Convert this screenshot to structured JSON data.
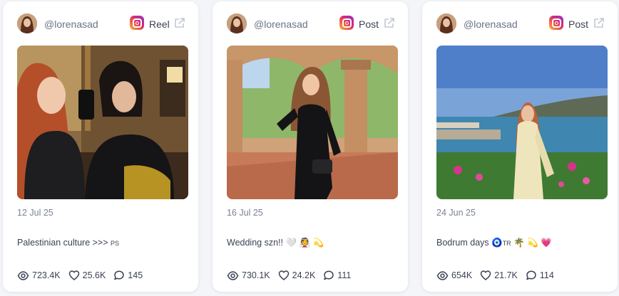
{
  "cards": [
    {
      "handle": "@lorenasad",
      "post_type": "Reel",
      "platform_icon": "instagram-icon",
      "date": "12 Jul 25",
      "caption": "Palestinian culture >>> ",
      "caption_tag": "PS",
      "views": "723.4K",
      "likes": "25.6K",
      "comments": "145"
    },
    {
      "handle": "@lorenasad",
      "post_type": "Post",
      "platform_icon": "instagram-icon",
      "date": "16 Jul 25",
      "caption": "Wedding szn!! 🤍 👰 💫",
      "caption_tag": "",
      "views": "730.1K",
      "likes": "24.2K",
      "comments": "111"
    },
    {
      "handle": "@lorenasad",
      "post_type": "Post",
      "platform_icon": "instagram-icon",
      "date": "24 Jun 25",
      "caption": "Bodrum days 🧿",
      "caption_tag": "TR",
      "caption_end": " 🌴 💫 💗",
      "views": "654K",
      "likes": "21.7K",
      "comments": "114"
    }
  ],
  "colors": {
    "card_bg": "#ffffff",
    "page_bg": "#f3f5f9",
    "text": "#3b4253",
    "muted": "#7a8294"
  }
}
